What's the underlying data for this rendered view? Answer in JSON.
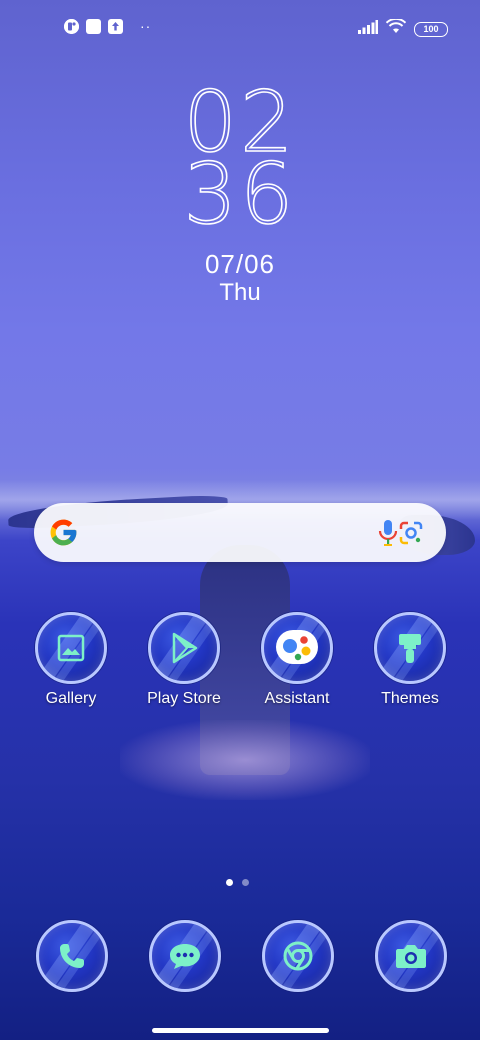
{
  "status_bar": {
    "left_icons": [
      "app-notification-icon",
      "white-square-icon",
      "upload-icon"
    ],
    "overflow_dots": "··",
    "right_icons": [
      "signal-icon",
      "wifi-icon"
    ],
    "battery": "100"
  },
  "clock": {
    "hours": "02",
    "minutes": "36",
    "date": "07/06",
    "day": "Thu"
  },
  "search": {
    "icons": [
      "google-icon",
      "microphone-icon",
      "google-lens-icon"
    ]
  },
  "apps": [
    {
      "label": "Gallery",
      "icon": "gallery-icon"
    },
    {
      "label": "Play Store",
      "icon": "play-store-icon"
    },
    {
      "label": "Assistant",
      "icon": "assistant-icon"
    },
    {
      "label": "Themes",
      "icon": "themes-brush-icon"
    }
  ],
  "page_indicator": {
    "total": 2,
    "current": 1
  },
  "dock": [
    {
      "icon": "phone-icon"
    },
    {
      "icon": "messages-icon"
    },
    {
      "icon": "chrome-icon"
    },
    {
      "icon": "camera-icon"
    }
  ],
  "colors": {
    "accent_mint": "#7df0c8",
    "icon_ring": "#b9c8ff"
  }
}
